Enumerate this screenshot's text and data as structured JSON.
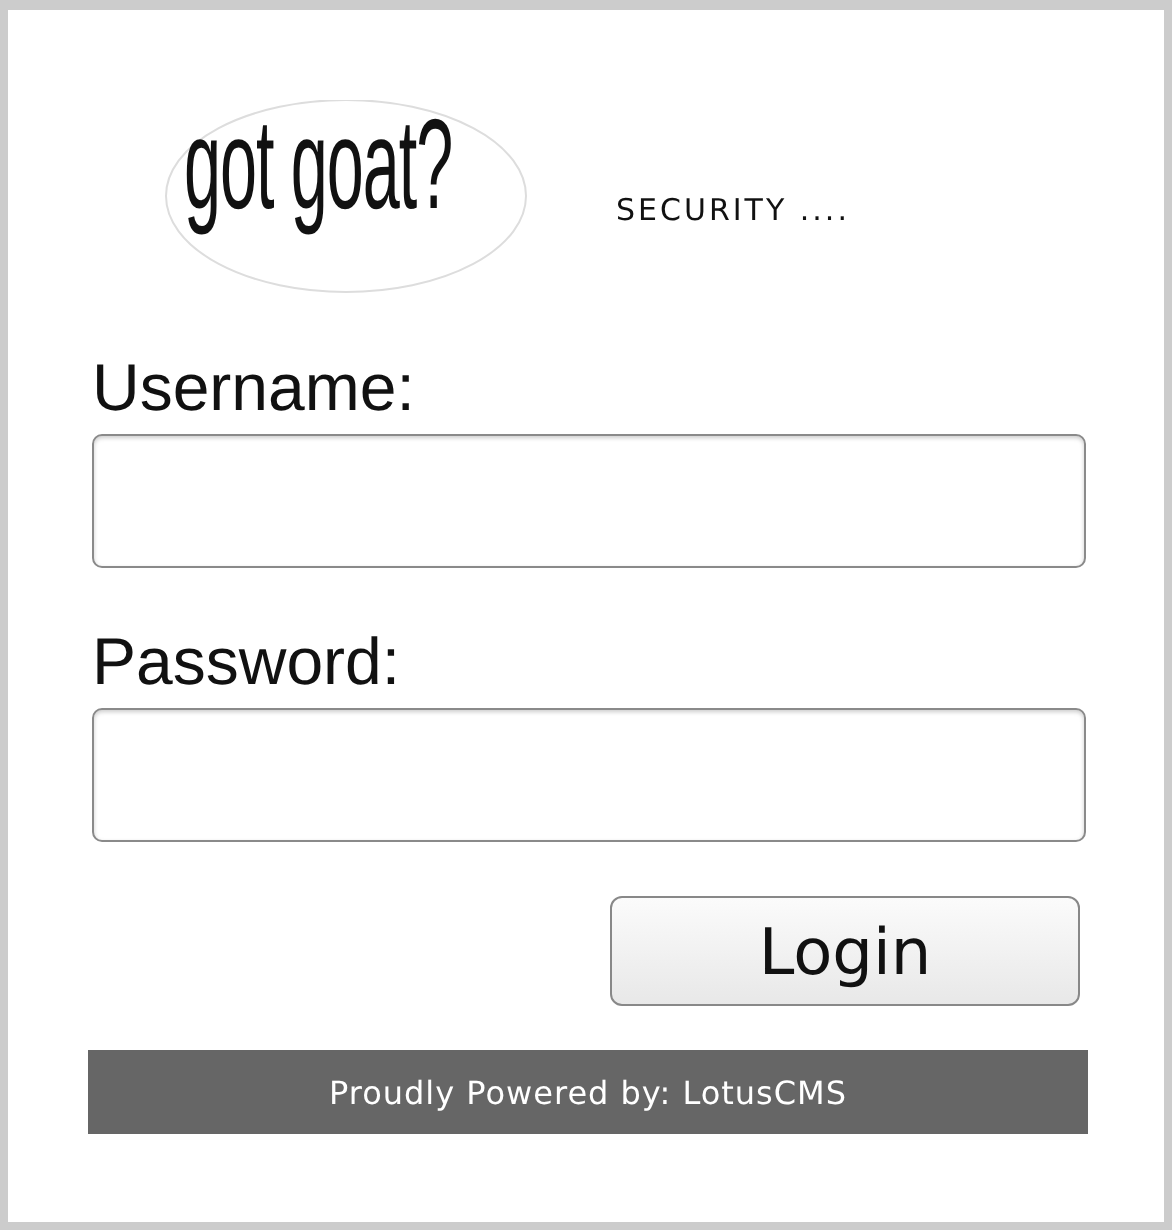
{
  "logo": {
    "text": "got goat?"
  },
  "tagline": "SECURITY ....",
  "fields": [
    {
      "label": "Username:"
    },
    {
      "label": "Password:"
    }
  ],
  "login_button": "Login",
  "footer": "Proudly Powered by: LotusCMS"
}
